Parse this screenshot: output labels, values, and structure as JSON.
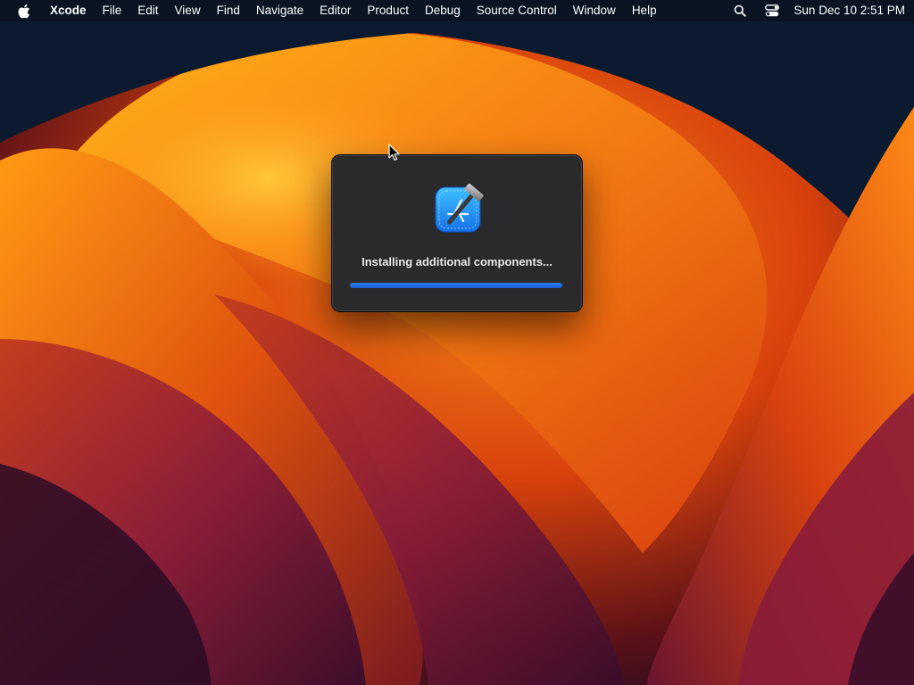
{
  "menubar": {
    "apple_icon": "apple-logo-icon",
    "app_name": "Xcode",
    "menus": [
      "File",
      "Edit",
      "View",
      "Find",
      "Navigate",
      "Editor",
      "Product",
      "Debug",
      "Source Control",
      "Window",
      "Help"
    ],
    "status_icons": [
      "search-icon",
      "control-center-icon"
    ],
    "clock": "Sun Dec 10  2:51 PM"
  },
  "dialog": {
    "icon": "xcode-app-icon",
    "message": "Installing additional components...",
    "progress": 1.0
  },
  "colors": {
    "progress_fill": "#2f7bf0",
    "dialog_background": "#2a2a2c",
    "wallpaper_primary": "#f06a14",
    "wallpaper_dark": "#0b1a2e"
  }
}
